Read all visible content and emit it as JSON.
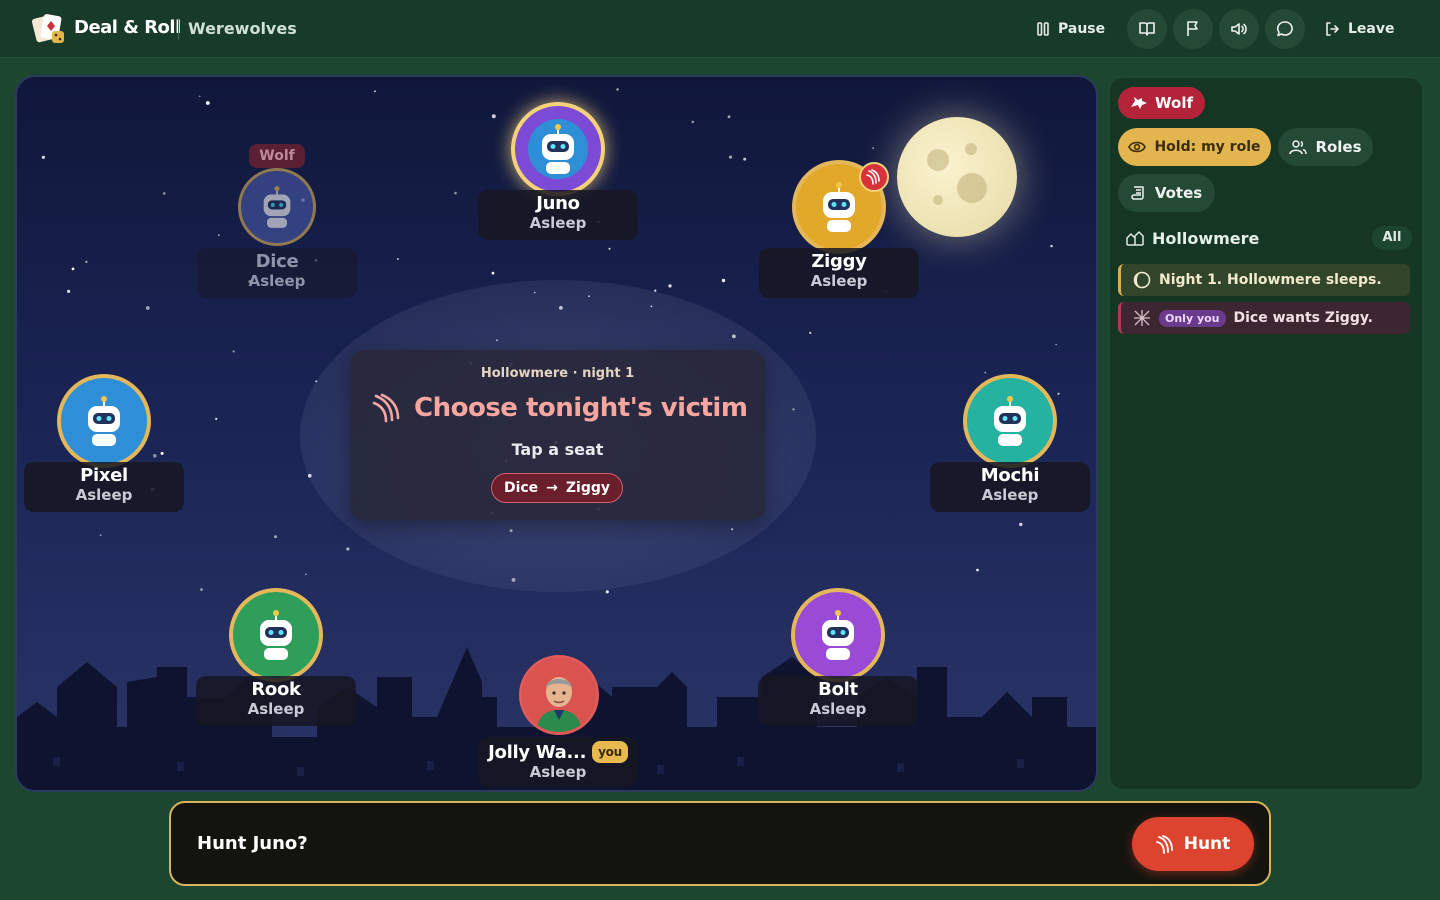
{
  "header": {
    "brand": "Deal & Roll",
    "game": "Werewolves",
    "pause_label": "Pause",
    "leave_label": "Leave",
    "icons": [
      "book-icon",
      "flag-icon",
      "volume-icon",
      "chat-icon"
    ]
  },
  "board": {
    "prompt": {
      "subtitle": "Hollowmere · night 1",
      "title": "Choose tonight's victim",
      "hint": "Tap a seat",
      "target_from": "Dice",
      "target_arrow": "→",
      "target_to": "Ziggy"
    },
    "players": [
      {
        "name": "Juno",
        "status": "Asleep",
        "ring": "#f4d27a",
        "bg": "#7b4bd6"
      },
      {
        "name": "Dice",
        "status": "Asleep",
        "ring": "#e4b85a",
        "bg": "#4a5aa8",
        "tag": "Wolf"
      },
      {
        "name": "Ziggy",
        "status": "Asleep",
        "ring": "#e4b85a",
        "bg": "#e1a82a"
      },
      {
        "name": "Pixel",
        "status": "Asleep",
        "ring": "#e4b85a",
        "bg": "#2f8fd6"
      },
      {
        "name": "Mochi",
        "status": "Asleep",
        "ring": "#e4b85a",
        "bg": "#25b2a0"
      },
      {
        "name": "Rook",
        "status": "Asleep",
        "ring": "#e4b85a",
        "bg": "#2f9e5a"
      },
      {
        "name": "Bolt",
        "status": "Asleep",
        "ring": "#e4b85a",
        "bg": "#9a4bd6"
      },
      {
        "name": "Jolly Wa...",
        "status": "Asleep",
        "you": "you",
        "ring": "#e05a5a",
        "bg": "#c94a4a"
      }
    ]
  },
  "side": {
    "role": "Wolf",
    "hold_label": "Hold: my role",
    "roles_label": "Roles",
    "votes_label": "Votes",
    "log_title": "Hollowmere",
    "log_filter": "All",
    "log": [
      {
        "text": "Night 1. Hollowmere sleeps."
      },
      {
        "badge": "Only you",
        "text": "Dice wants Ziggy."
      }
    ]
  },
  "action": {
    "question": "Hunt Juno?",
    "button": "Hunt"
  },
  "colors": {
    "accent_gold": "#e2b54e",
    "danger_red": "#dd4430",
    "wolf_red": "#b3243a",
    "background_green": "#1c4630"
  }
}
